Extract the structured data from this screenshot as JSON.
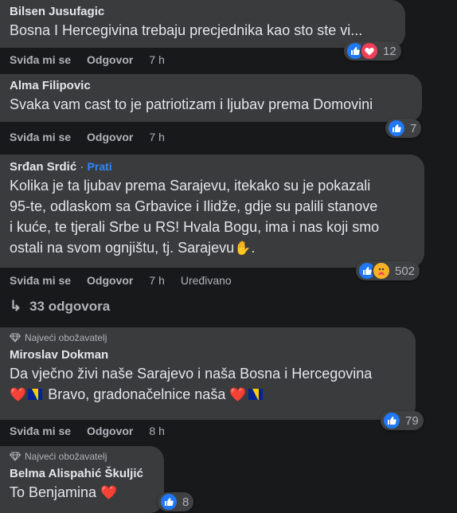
{
  "labels": {
    "like": "Sviđa mi se",
    "reply": "Odgovor",
    "edited": "Uređivano",
    "follow": "Prati",
    "top_fan": "Najveći obožavatelj"
  },
  "comments": [
    {
      "author": "Bilsen Jusufagic",
      "text": "Bosna I Hercegivina trebaju precjednika kao sto ste vi...",
      "time": "7 h",
      "reactions": "12"
    },
    {
      "author": "Alma Filipovic",
      "text": "Svaka vam cast to je patriotizam i ljubav prema Domovini",
      "time": "7 h",
      "reactions": "7"
    },
    {
      "author": "Srđan Srdić",
      "text_lines": [
        "Kolika je ta ljubav prema Sarajevu, itekako su je pokazali",
        "95-te, odlaskom sa Grbavice i Ilidže, gdje su palili stanove",
        "i kuće, te tjerali Srbe u RS! Hvala Bogu, ima i nas koji smo",
        "ostali na svom ognjištu, tj. Sarajevu"
      ],
      "time": "7 h",
      "reactions": "502"
    },
    {
      "author": "Miroslav Dokman",
      "text_line1": "Da vječno živi naše Sarajevo i naša Bosna i Hercegovina",
      "text_line2": "Bravo, gradonačelnice naša",
      "time": "8 h",
      "reactions": "79"
    },
    {
      "author": "Belma Alispahić Škuljić",
      "text": "To Benjamina",
      "reactions": "8"
    }
  ],
  "replies_link": "33 odgovora",
  "colors": {
    "background": "#18191a",
    "bubble": "#3a3b3c",
    "like": "#2078f4",
    "love": "#f33e58",
    "link": "#2d88ff"
  },
  "icons": [
    "like-icon",
    "love-icon",
    "care-icon",
    "reply-arrow-icon",
    "diamond-icon",
    "heart-emoji",
    "hand-emoji",
    "bih-flag"
  ]
}
